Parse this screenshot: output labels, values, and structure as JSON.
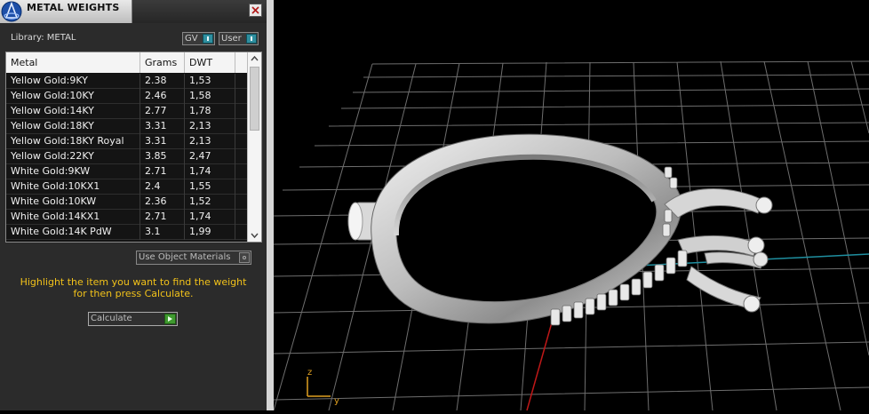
{
  "window": {
    "title": "METAL WEIGHTS"
  },
  "library": {
    "label": "Library: METAL"
  },
  "toggles": {
    "gv_label": "GV",
    "user_label": "User"
  },
  "table": {
    "columns": [
      "Metal",
      "Grams",
      "DWT"
    ],
    "rows": [
      [
        "Yellow Gold:9KY",
        "2.38",
        "1,53"
      ],
      [
        "Yellow Gold:10KY",
        "2.46",
        "1,58"
      ],
      [
        "Yellow Gold:14KY",
        "2.77",
        "1,78"
      ],
      [
        "Yellow Gold:18KY",
        "3.31",
        "2,13"
      ],
      [
        "Yellow Gold:18KY Royal",
        "3.31",
        "2,13"
      ],
      [
        "Yellow Gold:22KY",
        "3.85",
        "2,47"
      ],
      [
        "White Gold:9KW",
        "2.71",
        "1,74"
      ],
      [
        "White Gold:10KX1",
        "2.4",
        "1,55"
      ],
      [
        "White Gold:10KW",
        "2.36",
        "1,52"
      ],
      [
        "White Gold:14KX1",
        "2.71",
        "1,74"
      ],
      [
        "White Gold:14K PdW",
        "3.1",
        "1,99"
      ]
    ]
  },
  "use_object_materials": {
    "label": "Use Object Materials"
  },
  "hint": {
    "line1": "Highlight the item you want to find the weight",
    "line2": "for then press Calculate."
  },
  "calculate": {
    "label": "Calculate"
  },
  "viewport": {
    "axis_z": "z",
    "axis_y": "y"
  },
  "colors": {
    "hint_text": "#f2c21a",
    "panel_bg": "#2b2b2b",
    "toggle_on": "#2f8f9f",
    "calculate_go": "#3f9a2f",
    "axis_red": "#c01818",
    "axis_cyan": "#1f8fa0"
  }
}
